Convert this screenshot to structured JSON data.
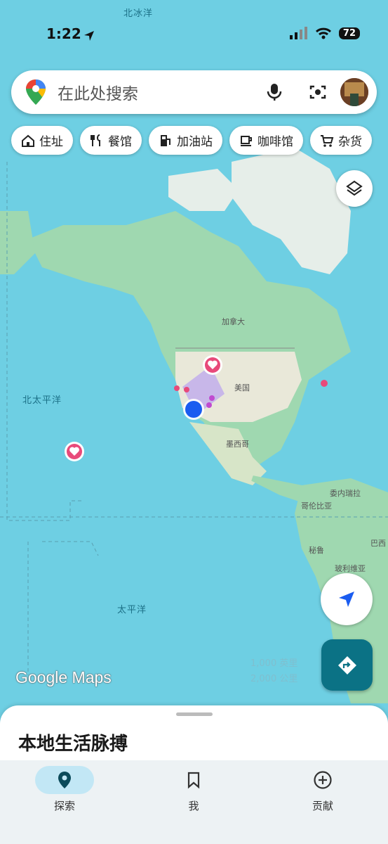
{
  "status": {
    "time": "1:22",
    "battery": "72"
  },
  "search": {
    "placeholder": "在此处搜索"
  },
  "chips": [
    {
      "label": "住址",
      "icon": "home-icon"
    },
    {
      "label": "餐馆",
      "icon": "restaurant-icon"
    },
    {
      "label": "加油站",
      "icon": "gas-station-icon"
    },
    {
      "label": "咖啡馆",
      "icon": "coffee-icon"
    },
    {
      "label": "杂货",
      "icon": "cart-icon"
    }
  ],
  "map_labels": {
    "arctic_ocean": "北冰洋",
    "north_pacific": "北太平洋",
    "pacific": "太平洋",
    "canada": "加拿大",
    "usa": "美国",
    "mexico": "墨西哥",
    "venezuela": "委内瑞拉",
    "colombia": "哥伦比亚",
    "peru": "秘鲁",
    "bolivia": "玻利维亚",
    "brazil": "巴西"
  },
  "logo": {
    "text": "Google Maps"
  },
  "scale": {
    "imperial": "1,000 英里",
    "metric": "2,000 公里"
  },
  "sheet": {
    "title": "本地生活脉搏"
  },
  "nav": [
    {
      "label": "探索",
      "icon": "location-pin-icon",
      "active": true
    },
    {
      "label": "我",
      "icon": "bookmark-icon",
      "active": false
    },
    {
      "label": "贡献",
      "icon": "add-circle-icon",
      "active": false
    }
  ],
  "colors": {
    "water": "#6ecfe3",
    "land": "#9fd8b0",
    "accent": "#0b7285",
    "active_nav": "#c2e7f5",
    "pin": "#e84a7a",
    "location": "#1a5cf0"
  }
}
